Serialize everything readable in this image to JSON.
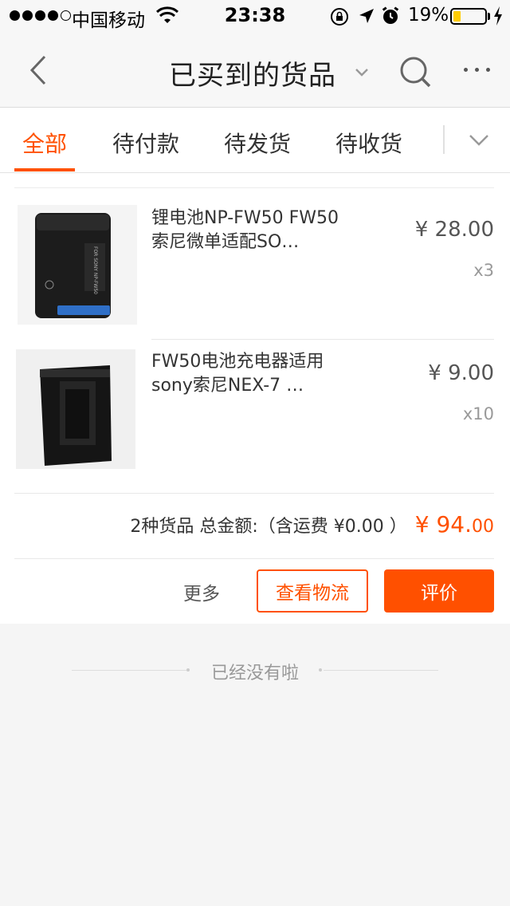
{
  "status_bar": {
    "carrier": "中国移动",
    "time": "23:38",
    "battery": "19%",
    "battery_level": 0.19
  },
  "nav": {
    "title": "已买到的货品"
  },
  "tabs": [
    {
      "label": "全部",
      "active": true
    },
    {
      "label": "待付款",
      "active": false
    },
    {
      "label": "待发货",
      "active": false
    },
    {
      "label": "待收货",
      "active": false
    }
  ],
  "order": {
    "items": [
      {
        "title": "锂电池NP-FW50 FW50索尼微单适配SO…",
        "price": "¥ 28.00",
        "qty": "x3",
        "image_label": "FOR SONY NP-FW50"
      },
      {
        "title": "FW50电池充电器适用sony索尼NEX-7 …",
        "price": "¥ 9.00",
        "qty": "x10"
      }
    ],
    "summary": {
      "count_text": "2种货品 总金额:（含运费 ¥0.00 ）",
      "total_currency": "¥",
      "total_int": "94.",
      "total_dec": "00"
    },
    "actions": {
      "more": "更多",
      "logistics": "查看物流",
      "review": "评价"
    }
  },
  "footer": {
    "end_text": "已经没有啦"
  },
  "colors": {
    "accent": "#ff5000"
  }
}
